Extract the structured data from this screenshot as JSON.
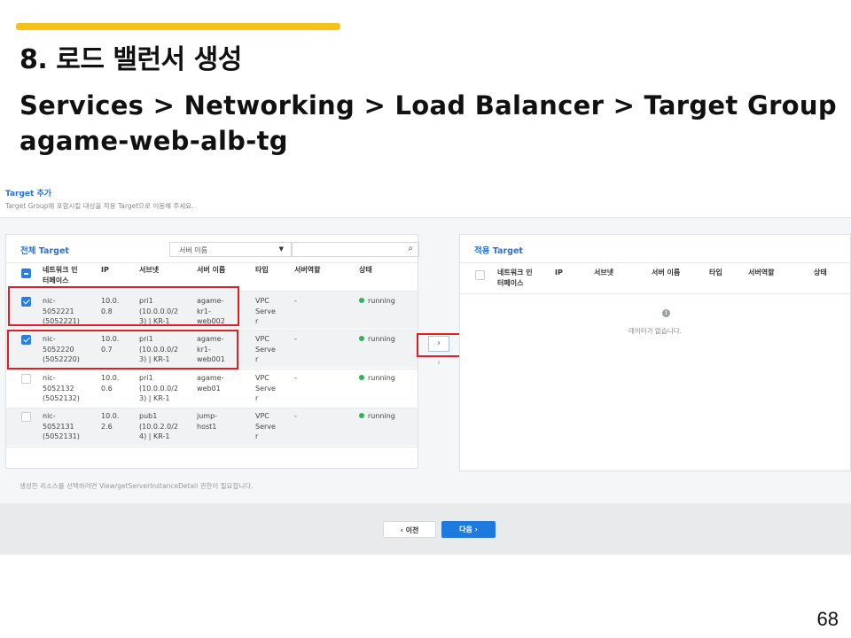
{
  "slide": {
    "title": "8. 로드 밸런서 생성",
    "path_line1": "Services > Networking > Load Balancer > Target Group",
    "path_line2": "agame-web-alb-tg",
    "page_number": "68",
    "accent_color": "#f6c21a"
  },
  "shot": {
    "title": "Target 추가",
    "subtitle": "Target Group에 포함시킬 대상을 적용 Target으로 이동해 주세요.",
    "note": "생성한 리소스를 선택하려면 View/getServerInstanceDetail 권한이 필요합니다.",
    "left_panel": {
      "title": "전체 Target",
      "filter_selected": "서버 이름",
      "search_placeholder": "",
      "headers": [
        "네트워크 인\n터페이스",
        "IP",
        "서브넷",
        "서버 이름",
        "타입",
        "서버역할",
        "상태"
      ],
      "rows": [
        {
          "checked": true,
          "nic": "nic-\n5052221\n(5052221)",
          "ip": "10.0.\n0.8",
          "subnet": "pri1\n(10.0.0.0/2\n3) | KR-1",
          "server": "agame-\nkr1-\nweb002",
          "type": "VPC\nServe\nr",
          "role": "-",
          "status": "running"
        },
        {
          "checked": true,
          "nic": "nic-\n5052220\n(5052220)",
          "ip": "10.0.\n0.7",
          "subnet": "pri1\n(10.0.0.0/2\n3) | KR-1",
          "server": "agame-\nkr1-\nweb001",
          "type": "VPC\nServe\nr",
          "role": "-",
          "status": "running"
        },
        {
          "checked": false,
          "nic": "nic-\n5052132\n(5052132)",
          "ip": "10.0.\n0.6",
          "subnet": "pri1\n(10.0.0.0/2\n3) | KR-1",
          "server": "agame-\nweb01",
          "type": "VPC\nServe\nr",
          "role": "-",
          "status": "running"
        },
        {
          "checked": false,
          "nic": "nic-\n5052131\n(5052131)",
          "ip": "10.0.\n2.6",
          "subnet": "pub1\n(10.0.2.0/2\n4) | KR-1",
          "server": "jump-\nhost1",
          "type": "VPC\nServe\nr",
          "role": "-",
          "status": "running"
        }
      ]
    },
    "right_panel": {
      "title": "적용 Target",
      "headers": [
        "네트워크 인\n터페이스",
        "IP",
        "서브넷",
        "서버 이름",
        "타입",
        "서버역할",
        "상태"
      ],
      "empty_icon": "!",
      "empty_text": "데이터가 없습니다."
    },
    "move_right": "›",
    "move_left": "‹",
    "prev_button": "‹  이전",
    "next_button": "다음  ›",
    "highlight_color": "#e02020",
    "status_color": "#33b05b"
  }
}
